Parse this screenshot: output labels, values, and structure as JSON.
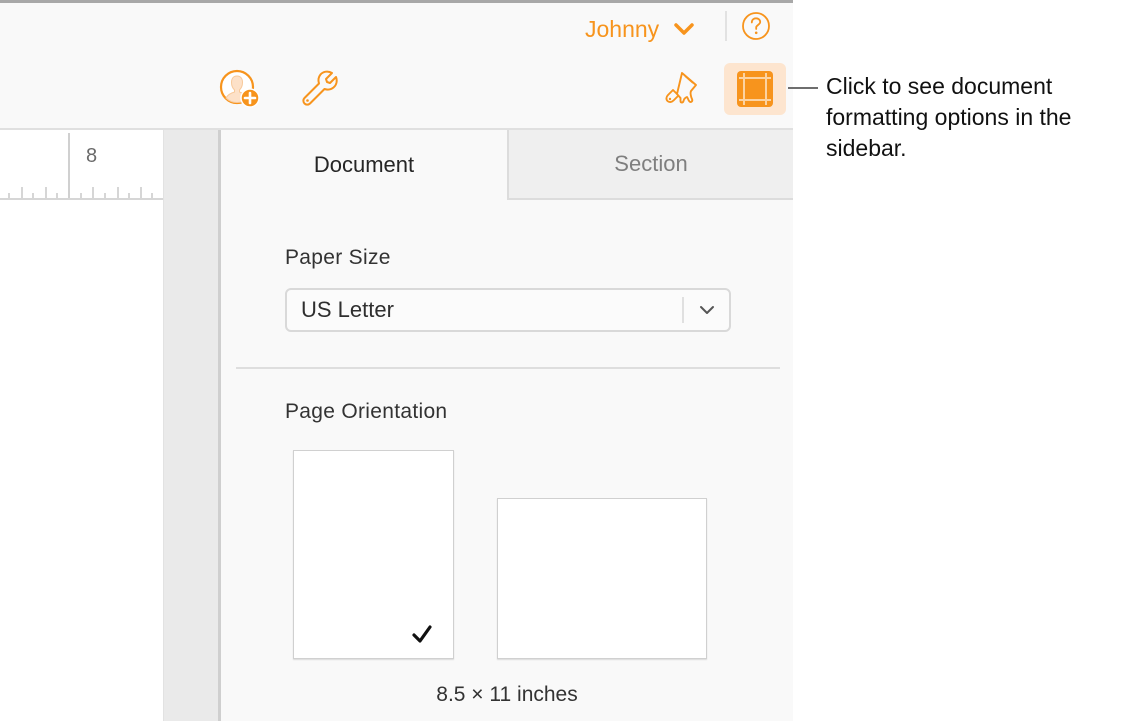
{
  "toolbar": {
    "user_name": "Johnny",
    "user_menu_icon": "chevron-down-icon",
    "help_icon": "question-circle-icon",
    "collaborate_icon": "add-person-icon",
    "wrench_icon": "wrench-icon",
    "format_icon": "paintbrush-icon",
    "document_icon": "document-layout-icon",
    "accent_color": "#f7941d",
    "document_button_active_bg": "#fde5cf"
  },
  "ruler": {
    "visible_number": "8"
  },
  "sidebar": {
    "tabs": [
      {
        "label": "Document",
        "selected": true
      },
      {
        "label": "Section",
        "selected": false
      }
    ],
    "paper_size": {
      "label": "Paper Size",
      "value": "US Letter"
    },
    "page_orientation": {
      "label": "Page Orientation",
      "options": [
        {
          "name": "Portrait",
          "selected": true
        },
        {
          "name": "Landscape",
          "selected": false
        }
      ],
      "size_text": "8.5 × 11 inches"
    }
  },
  "callout": {
    "text": "Click to see document formatting options in the sidebar."
  }
}
